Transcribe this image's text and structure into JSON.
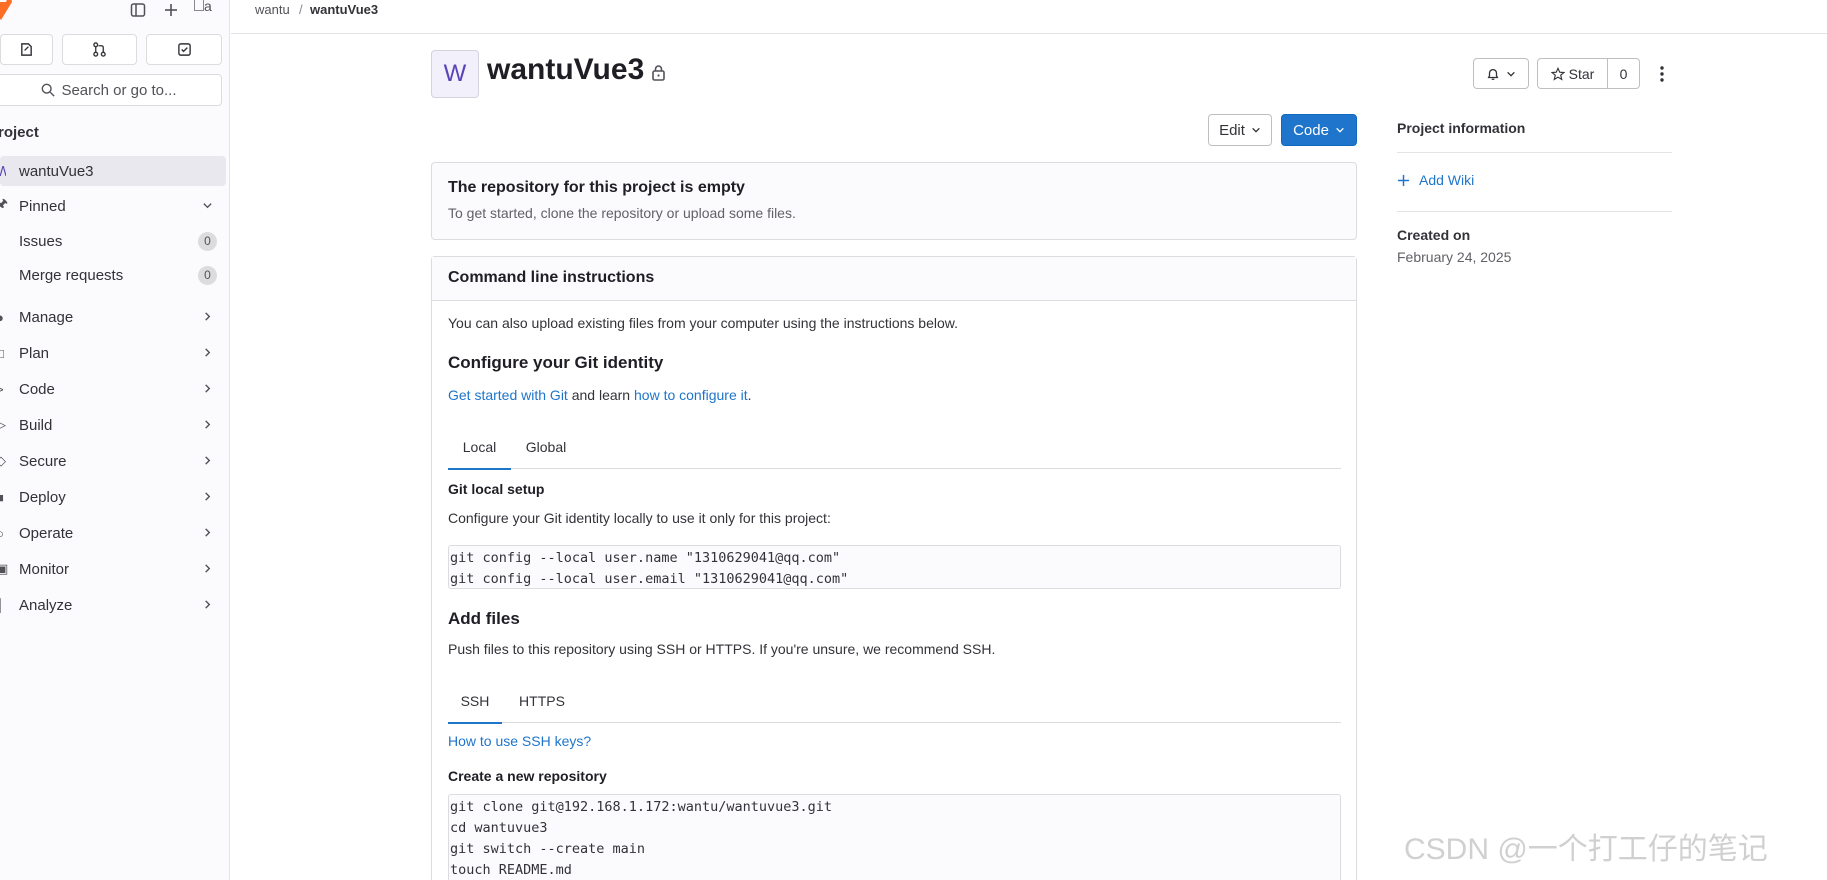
{
  "sidebar": {
    "search_placeholder": "Search or go to...",
    "section_title": "roject",
    "project_item": {
      "letter": "W",
      "label": "wantuVue3"
    },
    "pinned": {
      "label": "Pinned"
    },
    "pinned_items": [
      {
        "label": "Issues",
        "count": "0"
      },
      {
        "label": "Merge requests",
        "count": "0"
      }
    ],
    "nav_items": [
      {
        "label": "Manage"
      },
      {
        "label": "Plan"
      },
      {
        "label": "Code"
      },
      {
        "label": "Build"
      },
      {
        "label": "Secure"
      },
      {
        "label": "Deploy"
      },
      {
        "label": "Operate"
      },
      {
        "label": "Monitor"
      },
      {
        "label": "Analyze"
      }
    ],
    "avatar_alt": "a"
  },
  "breadcrumb": {
    "group": "wantu",
    "separator": "/",
    "project": "wantuVue3"
  },
  "header": {
    "avatar_letter": "W",
    "title": "wantuVue3",
    "star_label": "Star",
    "star_count": "0",
    "edit_label": "Edit",
    "code_label": "Code"
  },
  "empty_state": {
    "title": "The repository for this project is empty",
    "subtitle": "To get started, clone the repository or upload some files."
  },
  "cli": {
    "title": "Command line instructions",
    "intro": "You can also upload existing files from your computer using the instructions below.",
    "identity_heading": "Configure your Git identity",
    "get_started_link": "Get started with Git",
    "and_learn": " and learn ",
    "configure_link": "how to configure it",
    "period": ".",
    "identity_tabs": [
      "Local",
      "Global"
    ],
    "local_heading": "Git local setup",
    "local_desc": "Configure your Git identity locally to use it only for this project:",
    "local_code": "git config --local user.name \"1310629041@qq.com\"\ngit config --local user.email \"1310629041@qq.com\"",
    "add_files_heading": "Add files",
    "add_files_desc": "Push files to this repository using SSH or HTTPS. If you're unsure, we recommend SSH.",
    "protocol_tabs": [
      "SSH",
      "HTTPS"
    ],
    "ssh_keys_link": "How to use SSH keys?",
    "new_repo_heading": "Create a new repository",
    "new_repo_code": "git clone git@192.168.1.172:wantu/wantuvue3.git\ncd wantuvue3\ngit switch --create main\ntouch README.md"
  },
  "project_info": {
    "title": "Project information",
    "add_wiki": "Add Wiki",
    "created_label": "Created on",
    "created_value": "February 24, 2025"
  },
  "watermark": "CSDN @一个打工仔的笔记",
  "colors": {
    "accent": "#1f75cb",
    "avatar_bg": "#f1f0fb",
    "avatar_fg": "#5943b6"
  }
}
